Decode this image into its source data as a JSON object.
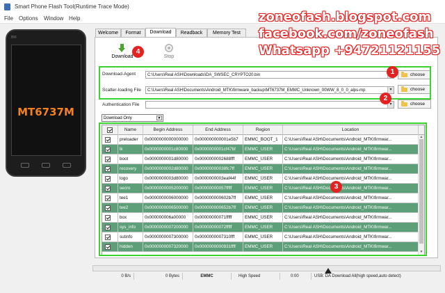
{
  "window": {
    "title": "Smart Phone Flash Tool(Runtime Trace Mode)"
  },
  "menu": [
    "File",
    "Options",
    "Window",
    "Help"
  ],
  "phone": {
    "brand": "BM",
    "model": "MT6737M"
  },
  "tabs": [
    "Welcome",
    "Format",
    "Download",
    "Readback",
    "Memory Test"
  ],
  "toolbar": {
    "download_label": "Download",
    "stop_label": "Stop"
  },
  "form": {
    "download_agent_label": "Download-Agent",
    "download_agent_value": "C:\\Users\\Real ASH\\Downloads\\DA_SWSEC_CRYPTO20.bin",
    "scatter_label": "Scatter-loading File",
    "scatter_value": "C:\\Users\\Real ASH\\Documents\\Android_MTK\\firmware_backup\\MT6737M_EMMC_Unknown_00WW_8_0_0_alps-mp",
    "auth_label": "Authentication File",
    "auth_value": "",
    "choose_label": "choose",
    "mode_value": "Download Only"
  },
  "table": {
    "columns": [
      "Name",
      "Begin Address",
      "End Address",
      "Region",
      "Location"
    ],
    "rows": [
      {
        "name": "preloader",
        "begin": "0x0000000000000000",
        "end": "0x000000000001e5b7",
        "region": "EMMC_BOOT_1",
        "location": "C:\\Users\\Real ASH\\Documents\\Android_MTK\\firmwar..."
      },
      {
        "name": "lk",
        "begin": "0x0000000001c80000",
        "end": "0x0000000001cf47bf",
        "region": "EMMC_USER",
        "location": "C:\\Users\\Real ASH\\Documents\\Android_MTK\\firmwar..."
      },
      {
        "name": "boot",
        "begin": "0x0000000001d80000",
        "end": "0x0000000002688fff",
        "region": "EMMC_USER",
        "location": "C:\\Users\\Real ASH\\Documents\\Android_MTK\\firmwar..."
      },
      {
        "name": "recovery",
        "begin": "0x0000000002d80000",
        "end": "0x00000000038fc7ff",
        "region": "EMMC_USER",
        "location": "C:\\Users\\Real ASH\\Documents\\Android_MTK\\firmwar..."
      },
      {
        "name": "logo",
        "begin": "0x0000000003d80000",
        "end": "0x0000000003eaf44f",
        "region": "EMMC_USER",
        "location": "C:\\Users\\Real ASH\\Documents\\Android_MTK\\firmwar..."
      },
      {
        "name": "secro",
        "begin": "0x0000000005200000",
        "end": "0x00000000057fffff",
        "region": "EMMC_USER",
        "location": "C:\\Users\\Real ASH\\Documents\\Android_MTK\\firmwar..."
      },
      {
        "name": "tee1",
        "begin": "0x0000000006000000",
        "end": "0x000000000602b7ff",
        "region": "EMMC_USER",
        "location": "C:\\Users\\Real ASH\\Documents\\Android_MTK\\firmwar..."
      },
      {
        "name": "tee2",
        "begin": "0x0000000006500000",
        "end": "0x000000000652b7ff",
        "region": "EMMC_USER",
        "location": "C:\\Users\\Real ASH\\Documents\\Android_MTK\\firmwar..."
      },
      {
        "name": "box",
        "begin": "0x000000006a00000",
        "end": "0x00000000071fffff",
        "region": "EMMC_USER",
        "location": "C:\\Users\\Real ASH\\Documents\\Android_MTK\\firmwar..."
      },
      {
        "name": "sys_info",
        "begin": "0x0000000007200000",
        "end": "0x00000000072fffff",
        "region": "EMMC_USER",
        "location": "C:\\Users\\Real ASH\\Documents\\Android_MTK\\firmwar..."
      },
      {
        "name": "sutinfo",
        "begin": "0x0000000007300000",
        "end": "0x0000000007310fff",
        "region": "EMMC_USER",
        "location": "C:\\Users\\Real ASH\\Documents\\Android_MTK\\firmwar..."
      },
      {
        "name": "hidden",
        "begin": "0x0000000007320000",
        "end": "0x0000000000931ffff",
        "region": "EMMC_USER",
        "location": "C:\\Users\\Real ASH\\Documents\\Android_MTK\\firmwar..."
      }
    ]
  },
  "status": {
    "speed": "0 B/s",
    "bytes": "0 Bytes",
    "storage": "EMMC",
    "usb_speed": "High Speed",
    "time": "0:00",
    "connection": "USB: DA Download All(high speed,auto detect)"
  },
  "annotations": {
    "badge1": "1",
    "badge2": "2",
    "badge3": "3",
    "badge4": "4"
  },
  "watermark": {
    "line1": "zoneofash.blogspot.com",
    "line2": "facebook.com/zoneofash",
    "line3": "Whatsapp +94721121155"
  },
  "colors": {
    "row_even": "#ffffff",
    "row_odd": "#5c9f79",
    "highlight": "#39d42d",
    "badge": "#e32222",
    "watermark_outline": "#e02121",
    "model_text": "#f5821f"
  }
}
